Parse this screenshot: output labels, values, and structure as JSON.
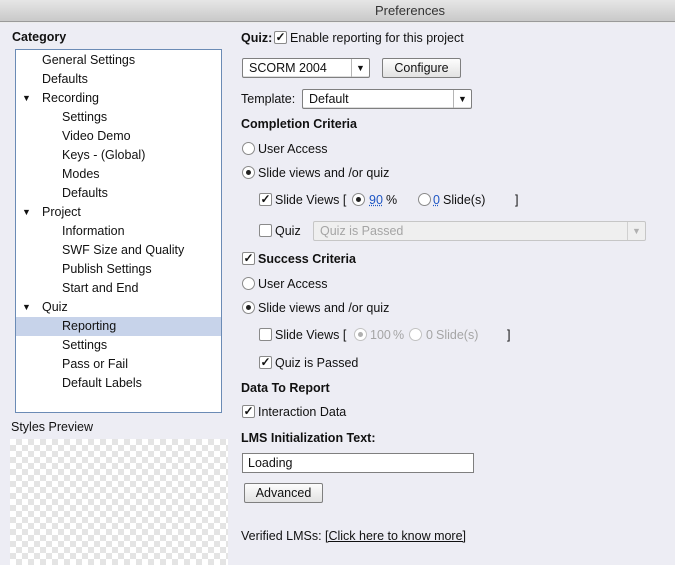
{
  "window": {
    "title": "Preferences"
  },
  "sidebar": {
    "category_label": "Category",
    "items": [
      {
        "label": "General Settings"
      },
      {
        "label": "Defaults"
      },
      {
        "label": "Recording"
      },
      {
        "label": "Settings"
      },
      {
        "label": "Video Demo"
      },
      {
        "label": "Keys - (Global)"
      },
      {
        "label": "Modes"
      },
      {
        "label": "Defaults"
      },
      {
        "label": "Project"
      },
      {
        "label": "Information"
      },
      {
        "label": "SWF Size and Quality"
      },
      {
        "label": "Publish Settings"
      },
      {
        "label": "Start and End"
      },
      {
        "label": "Quiz"
      },
      {
        "label": "Reporting"
      },
      {
        "label": "Settings"
      },
      {
        "label": "Pass or Fail"
      },
      {
        "label": "Default Labels"
      }
    ],
    "selected": "Reporting",
    "styles_preview_label": "Styles Preview"
  },
  "main": {
    "quiz_label": "Quiz:",
    "enable_reporting": {
      "label": "Enable reporting for this project",
      "checked": true
    },
    "lms_select": {
      "value": "SCORM 2004"
    },
    "configure_button": "Configure",
    "template": {
      "label": "Template:",
      "value": "Default"
    },
    "completion": {
      "heading": "Completion Criteria",
      "user_access": "User Access",
      "slide_views_or_quiz": "Slide views and /or quiz",
      "slide_views_label": "Slide Views [",
      "percent_value": "90",
      "percent_sign": "%",
      "slides_value": "0",
      "slides_label": "Slide(s)",
      "close_bracket": "]",
      "quiz_label": "Quiz",
      "quiz_select": "Quiz is Passed"
    },
    "success": {
      "heading": "Success Criteria",
      "user_access": "User Access",
      "slide_views_or_quiz": "Slide views and /or quiz",
      "slide_views_label": "Slide Views [",
      "percent_value": "100",
      "percent_sign": "%",
      "slides_value": "0",
      "slides_label": "Slide(s)",
      "close_bracket": "]",
      "quiz_passed": "Quiz is Passed"
    },
    "data_to_report": {
      "heading": "Data To Report",
      "interaction_data": "Interaction Data"
    },
    "lms_init": {
      "label": "LMS Initialization Text:",
      "value": "Loading"
    },
    "advanced_button": "Advanced",
    "verified": {
      "label": "Verified LMSs:",
      "link": "[Click here to know more]"
    }
  }
}
